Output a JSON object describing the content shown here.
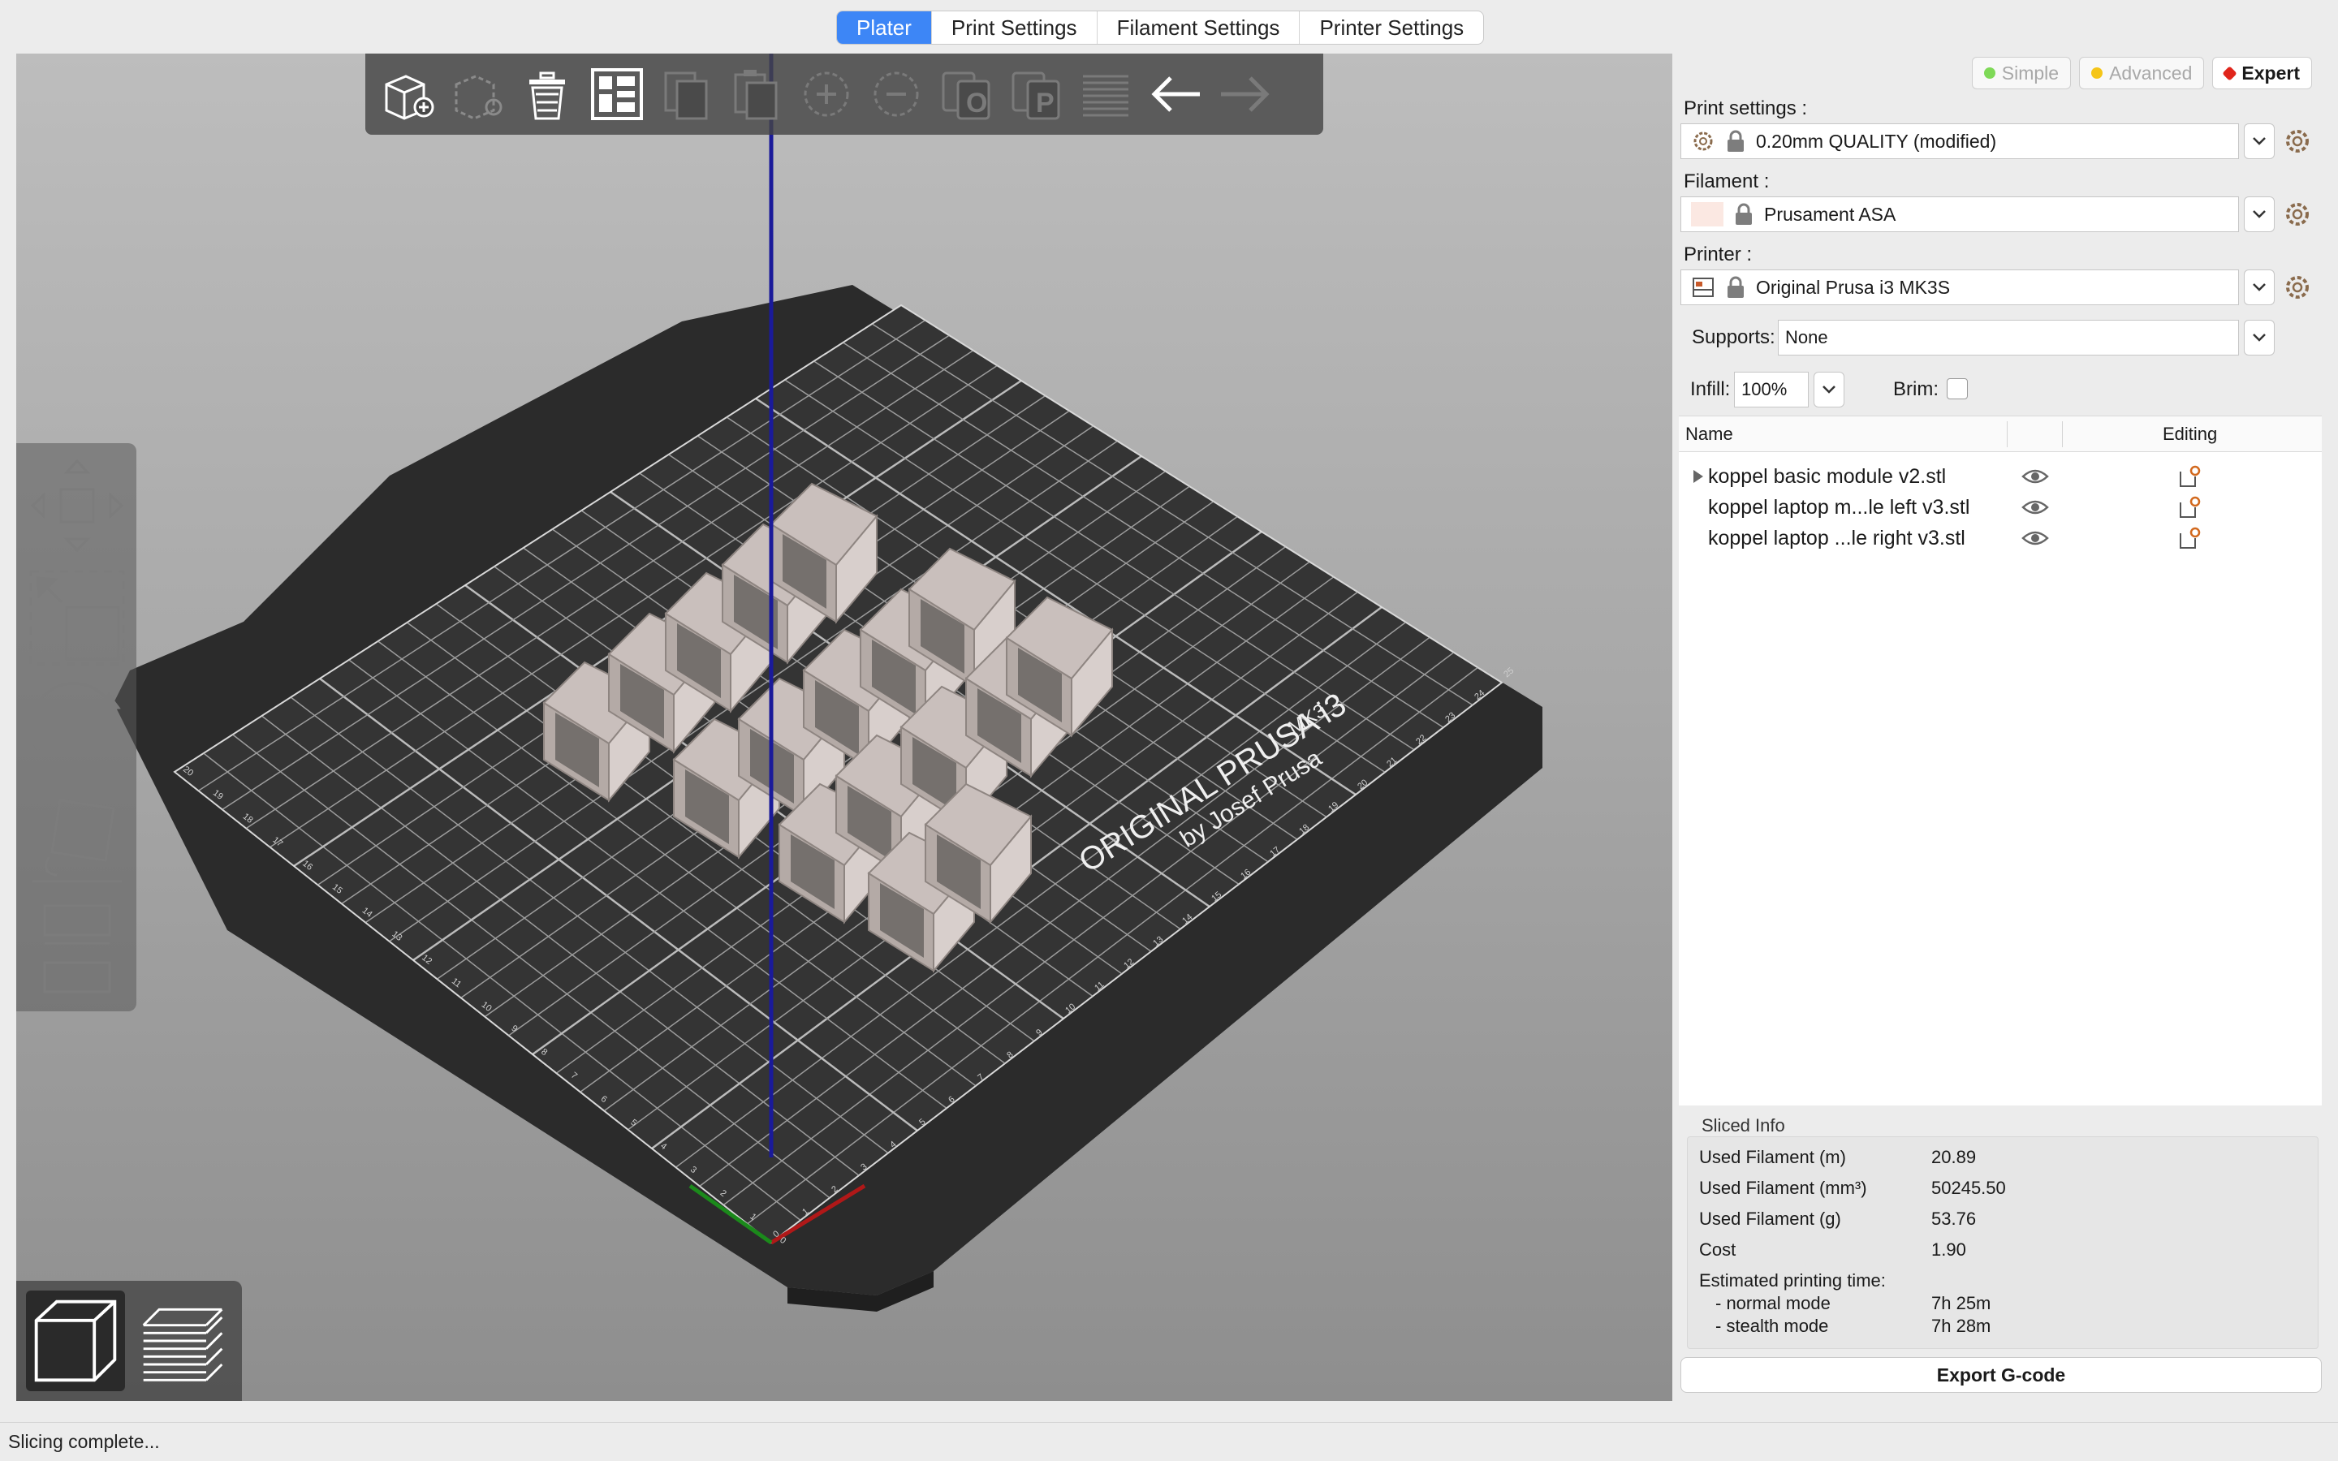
{
  "tabs": [
    {
      "label": "Plater",
      "active": true
    },
    {
      "label": "Print Settings",
      "active": false
    },
    {
      "label": "Filament Settings",
      "active": false
    },
    {
      "label": "Printer Settings",
      "active": false
    }
  ],
  "toolbar": {
    "icons": [
      "add-object-icon",
      "delete-icon",
      "delete-all-icon",
      "arrange-icon",
      "copy-icon",
      "paste-icon",
      "add-instance-icon",
      "remove-instance-icon",
      "split-objects-icon",
      "split-parts-icon",
      "layers-editing-icon",
      "undo-icon",
      "redo-icon"
    ]
  },
  "gizmos": [
    "move-icon",
    "scale-icon",
    "rotate-icon",
    "place-on-face-icon",
    "cut-icon",
    "support-paint-icon"
  ],
  "bed": {
    "brand_line1": "ORIGINAL PRUSA i3",
    "brand_model": "MK3",
    "brand_line2": "by Josef Prusa",
    "x_ticks": [
      "0",
      "1",
      "2",
      "3",
      "4",
      "5",
      "6",
      "7",
      "8",
      "9",
      "10",
      "11",
      "12",
      "13",
      "14",
      "15",
      "16",
      "17",
      "18",
      "19",
      "20",
      "21",
      "22",
      "23",
      "24",
      "25"
    ],
    "y_ticks": [
      "0",
      "1",
      "2",
      "3",
      "4",
      "5",
      "6",
      "7",
      "8",
      "9",
      "10",
      "11",
      "12",
      "13",
      "14",
      "15",
      "16",
      "17",
      "18",
      "19",
      "20"
    ]
  },
  "sidebar": {
    "modes": [
      {
        "label": "Simple",
        "color": "#7ed957",
        "active": false
      },
      {
        "label": "Advanced",
        "color": "#f5c518",
        "active": false
      },
      {
        "label": "Expert",
        "color": "#e0251b",
        "active": true
      }
    ],
    "print_settings_label": "Print settings :",
    "print_settings_value": "0.20mm QUALITY (modified)",
    "filament_label": "Filament :",
    "filament_value": "Prusament ASA",
    "filament_color": "#fbe8e2",
    "printer_label": "Printer :",
    "printer_value": "Original Prusa i3 MK3S",
    "supports_label": "Supports:",
    "supports_value": "None",
    "infill_label": "Infill:",
    "infill_value": "100%",
    "brim_label": "Brim:",
    "brim_checked": false
  },
  "object_list": {
    "col_name": "Name",
    "col_editing": "Editing",
    "items": [
      {
        "name": "koppel basic module v2.stl",
        "expandable": true
      },
      {
        "name": "koppel laptop m...le left v3.stl",
        "expandable": false
      },
      {
        "name": "koppel laptop ...le right v3.stl",
        "expandable": false
      }
    ]
  },
  "sliced_info": {
    "title": "Sliced Info",
    "used_filament_m_label": "Used Filament (m)",
    "used_filament_m": "20.89",
    "used_filament_mm3_label": "Used Filament (mm³)",
    "used_filament_mm3": "50245.50",
    "used_filament_g_label": "Used Filament (g)",
    "used_filament_g": "53.76",
    "cost_label": "Cost",
    "cost": "1.90",
    "est_time_label": "Estimated printing time:",
    "normal_mode_label": "- normal mode",
    "normal_mode": "7h 25m",
    "stealth_mode_label": "- stealth mode",
    "stealth_mode": "7h 28m"
  },
  "export_label": "Export G-code",
  "status_text": "Slicing complete..."
}
